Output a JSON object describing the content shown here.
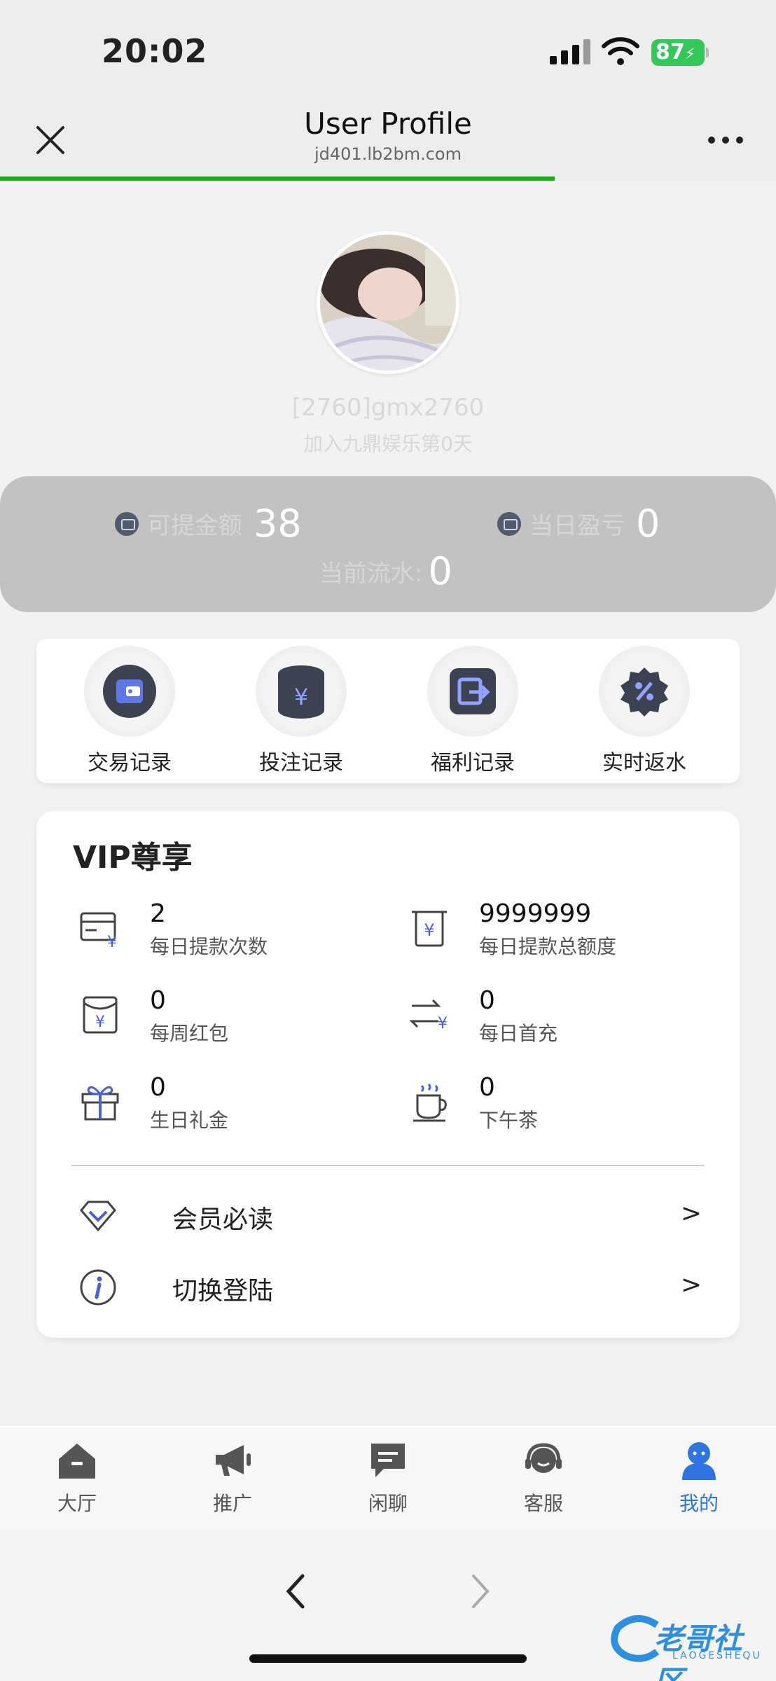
{
  "status_bar": {
    "time": "20:02",
    "battery": "87"
  },
  "header": {
    "title": "User Profile",
    "url": "jd401.lb2bm.com",
    "page_load_progress": 0.715
  },
  "profile": {
    "username": "[2760]gmx2760",
    "joined": "加入九鼎娱乐第0天"
  },
  "stats": {
    "withdrawable_label": "可提金额",
    "withdrawable_value": "38",
    "daily_pl_label": "当日盈亏",
    "daily_pl_value": "0",
    "turnover_label": "当前流水:",
    "turnover_value": "0"
  },
  "actions": [
    {
      "label": "交易记录",
      "icon": "wallet-icon"
    },
    {
      "label": "投注记录",
      "icon": "yen-database-icon"
    },
    {
      "label": "福利记录",
      "icon": "exchange-icon"
    },
    {
      "label": "实时返水",
      "icon": "percent-gear-icon"
    }
  ],
  "vip": {
    "title": "VIP尊享",
    "perks": [
      {
        "value": "2",
        "label": "每日提款次数",
        "icon": "card-yen-icon"
      },
      {
        "value": "9999999",
        "label": "每日提款总额度",
        "icon": "receipt-yen-icon"
      },
      {
        "value": "0",
        "label": "每周红包",
        "icon": "red-envelope-icon"
      },
      {
        "value": "0",
        "label": "每日首充",
        "icon": "transfer-yen-icon"
      },
      {
        "value": "0",
        "label": "生日礼金",
        "icon": "gift-icon"
      },
      {
        "value": "0",
        "label": "下午茶",
        "icon": "coffee-icon"
      }
    ],
    "links": [
      {
        "label": "会员必读",
        "arrow": ">",
        "icon": "diamond-icon"
      },
      {
        "label": "切换登陆",
        "arrow": ">",
        "icon": "info-icon"
      }
    ]
  },
  "tabs": [
    {
      "label": "大厅",
      "icon": "home-icon"
    },
    {
      "label": "推广",
      "icon": "megaphone-icon"
    },
    {
      "label": "闲聊",
      "icon": "chat-icon"
    },
    {
      "label": "客服",
      "icon": "headset-icon"
    },
    {
      "label": "我的",
      "icon": "user-icon",
      "active": true
    }
  ],
  "watermark": {
    "text": "老哥社区",
    "sub": "LAOGESHEQU"
  },
  "colors": {
    "accent": "#2f74e0",
    "progress": "#1aad19",
    "icon_blue": "#4a5fd8"
  }
}
